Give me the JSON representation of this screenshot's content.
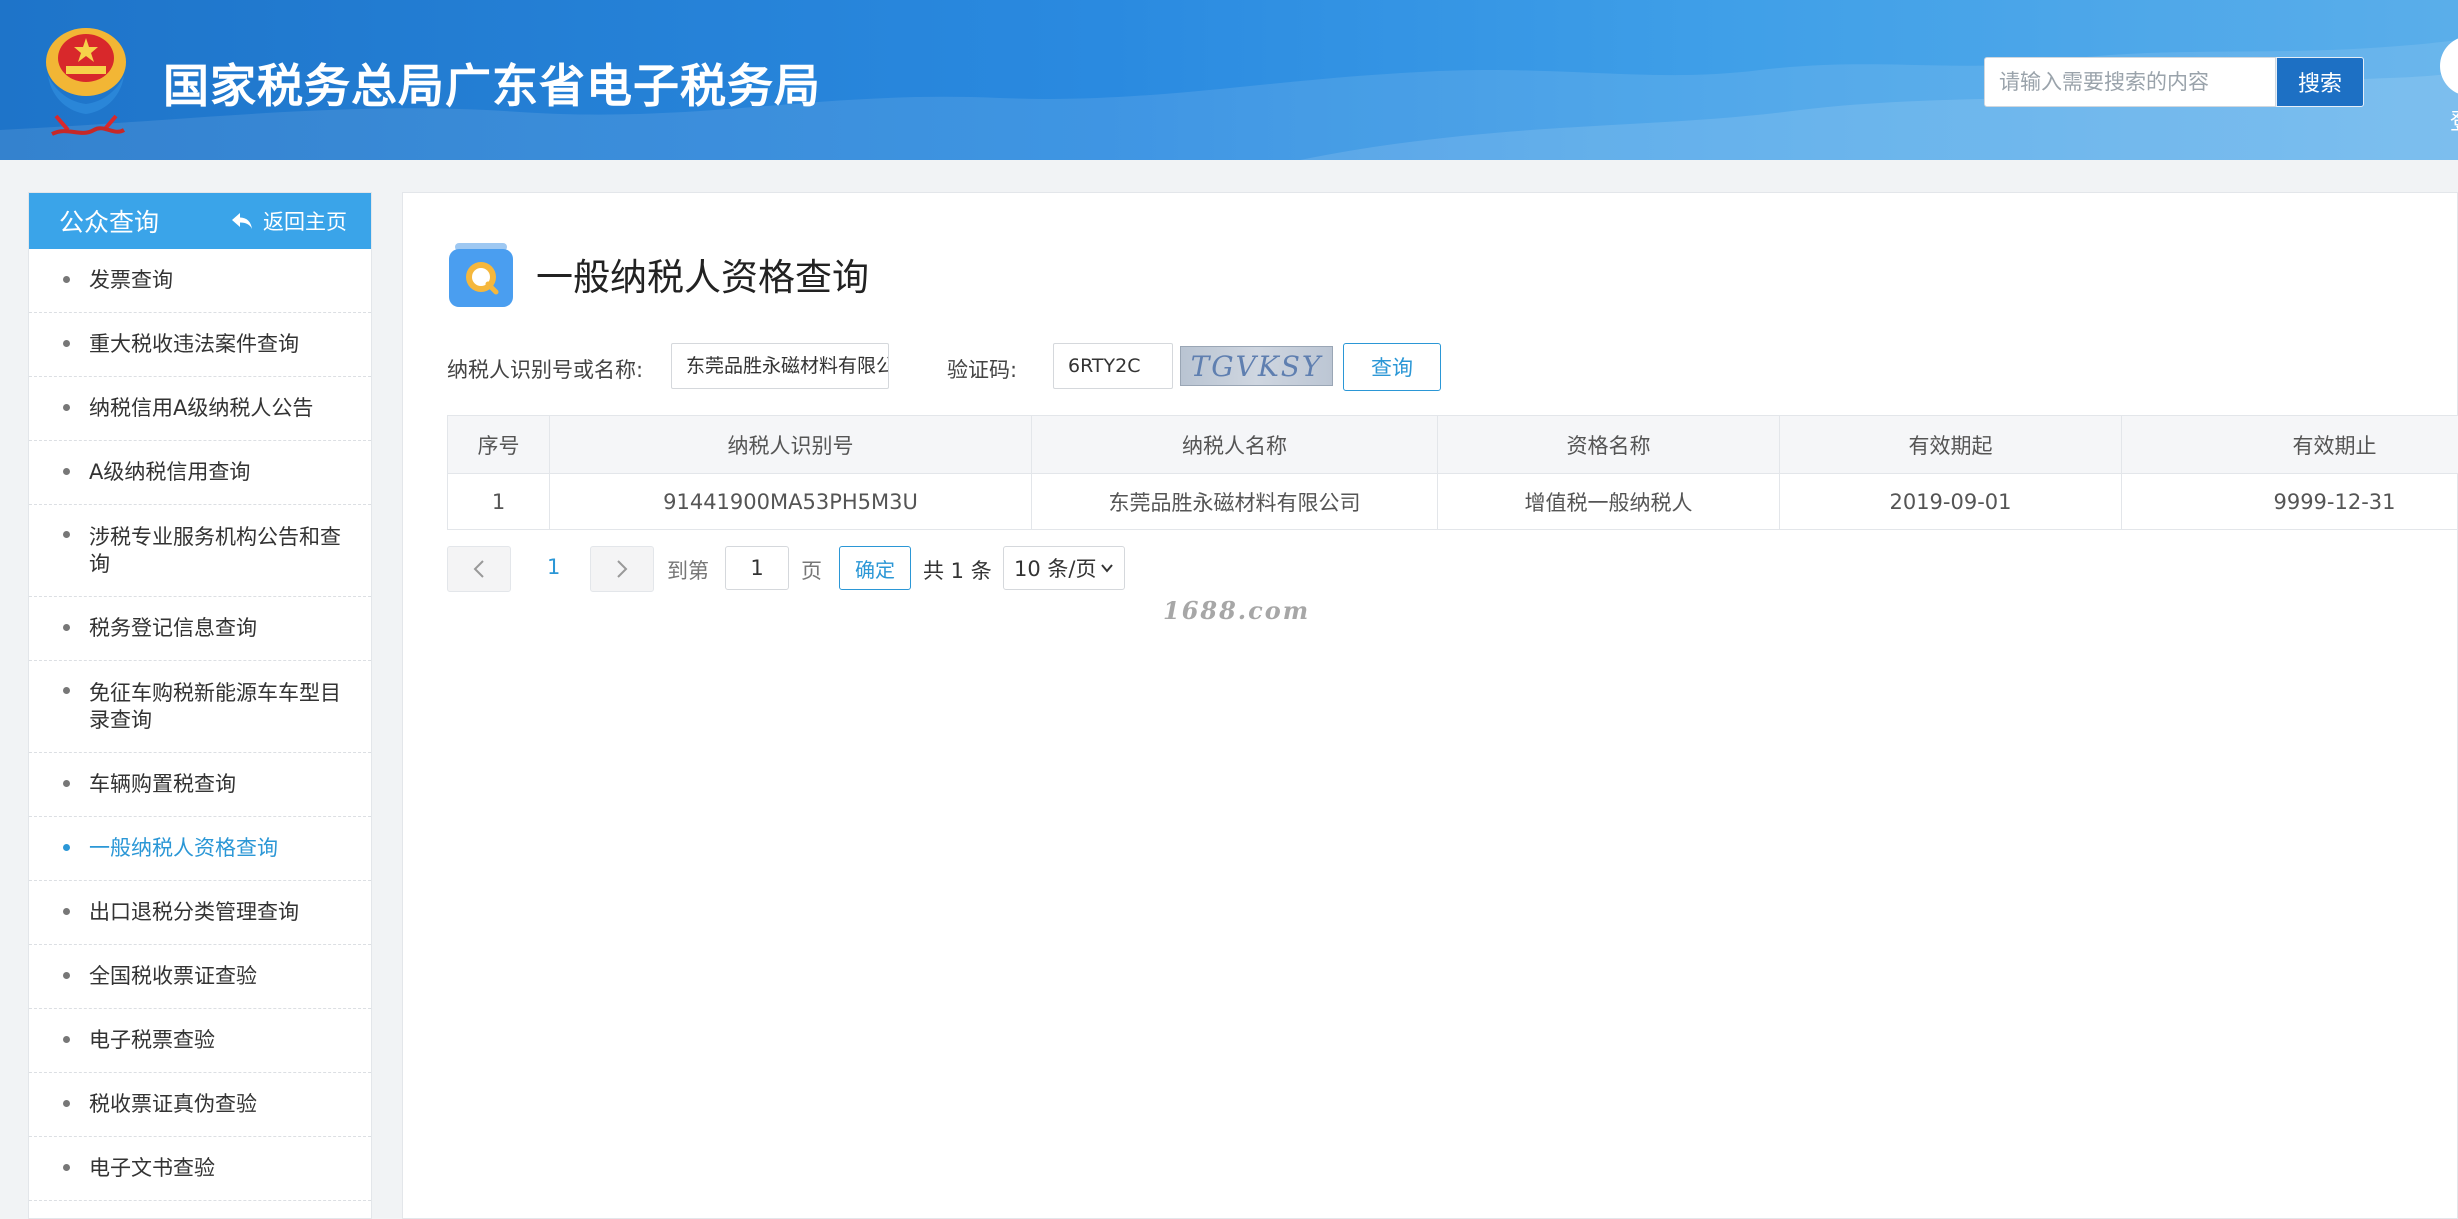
{
  "header": {
    "site_title": "国家税务总局广东省电子税务局",
    "search_placeholder": "请输入需要搜索的内容",
    "search_button": "搜索",
    "login_label": "登"
  },
  "sidebar": {
    "title": "公众查询",
    "back_label": "返回主页",
    "items": [
      {
        "label": "发票查询",
        "active": false
      },
      {
        "label": "重大税收违法案件查询",
        "active": false
      },
      {
        "label": "纳税信用A级纳税人公告",
        "active": false
      },
      {
        "label": "A级纳税信用查询",
        "active": false
      },
      {
        "label": "涉税专业服务机构公告和查询",
        "active": false
      },
      {
        "label": "税务登记信息查询",
        "active": false
      },
      {
        "label": "免征车购税新能源车车型目录查询",
        "active": false
      },
      {
        "label": "车辆购置税查询",
        "active": false
      },
      {
        "label": "一般纳税人资格查询",
        "active": true
      },
      {
        "label": "出口退税分类管理查询",
        "active": false
      },
      {
        "label": "全国税收票证查验",
        "active": false
      },
      {
        "label": "电子税票查验",
        "active": false
      },
      {
        "label": "税收票证真伪查验",
        "active": false
      },
      {
        "label": "电子文书查验",
        "active": false
      }
    ]
  },
  "main": {
    "page_title": "一般纳税人资格查询",
    "form": {
      "taxpayer_label": "纳税人识别号或名称:",
      "taxpayer_value": "东莞品胜永磁材料有限公",
      "captcha_label": "验证码:",
      "captcha_value": "6RTY2C",
      "captcha_image_text": "TGVKSY",
      "query_button": "查询"
    },
    "table": {
      "columns": [
        "序号",
        "纳税人识别号",
        "纳税人名称",
        "资格名称",
        "有效期起",
        "有效期止"
      ],
      "rows": [
        [
          "1",
          "91441900MA53PH5M3U",
          "东莞品胜永磁材料有限公司",
          "增值税一般纳税人",
          "2019-09-01",
          "9999-12-31"
        ]
      ]
    },
    "pagination": {
      "current_page": "1",
      "goto_label": "到第",
      "goto_value": "1",
      "page_unit": "页",
      "confirm": "确定",
      "total": "共 1 条",
      "page_size": "10 条/页"
    },
    "watermark": "1688.com"
  },
  "colors": {
    "header_blue": "#1e74c9",
    "sidebar_head": "#3aa4e9",
    "accent": "#2b97d6"
  }
}
